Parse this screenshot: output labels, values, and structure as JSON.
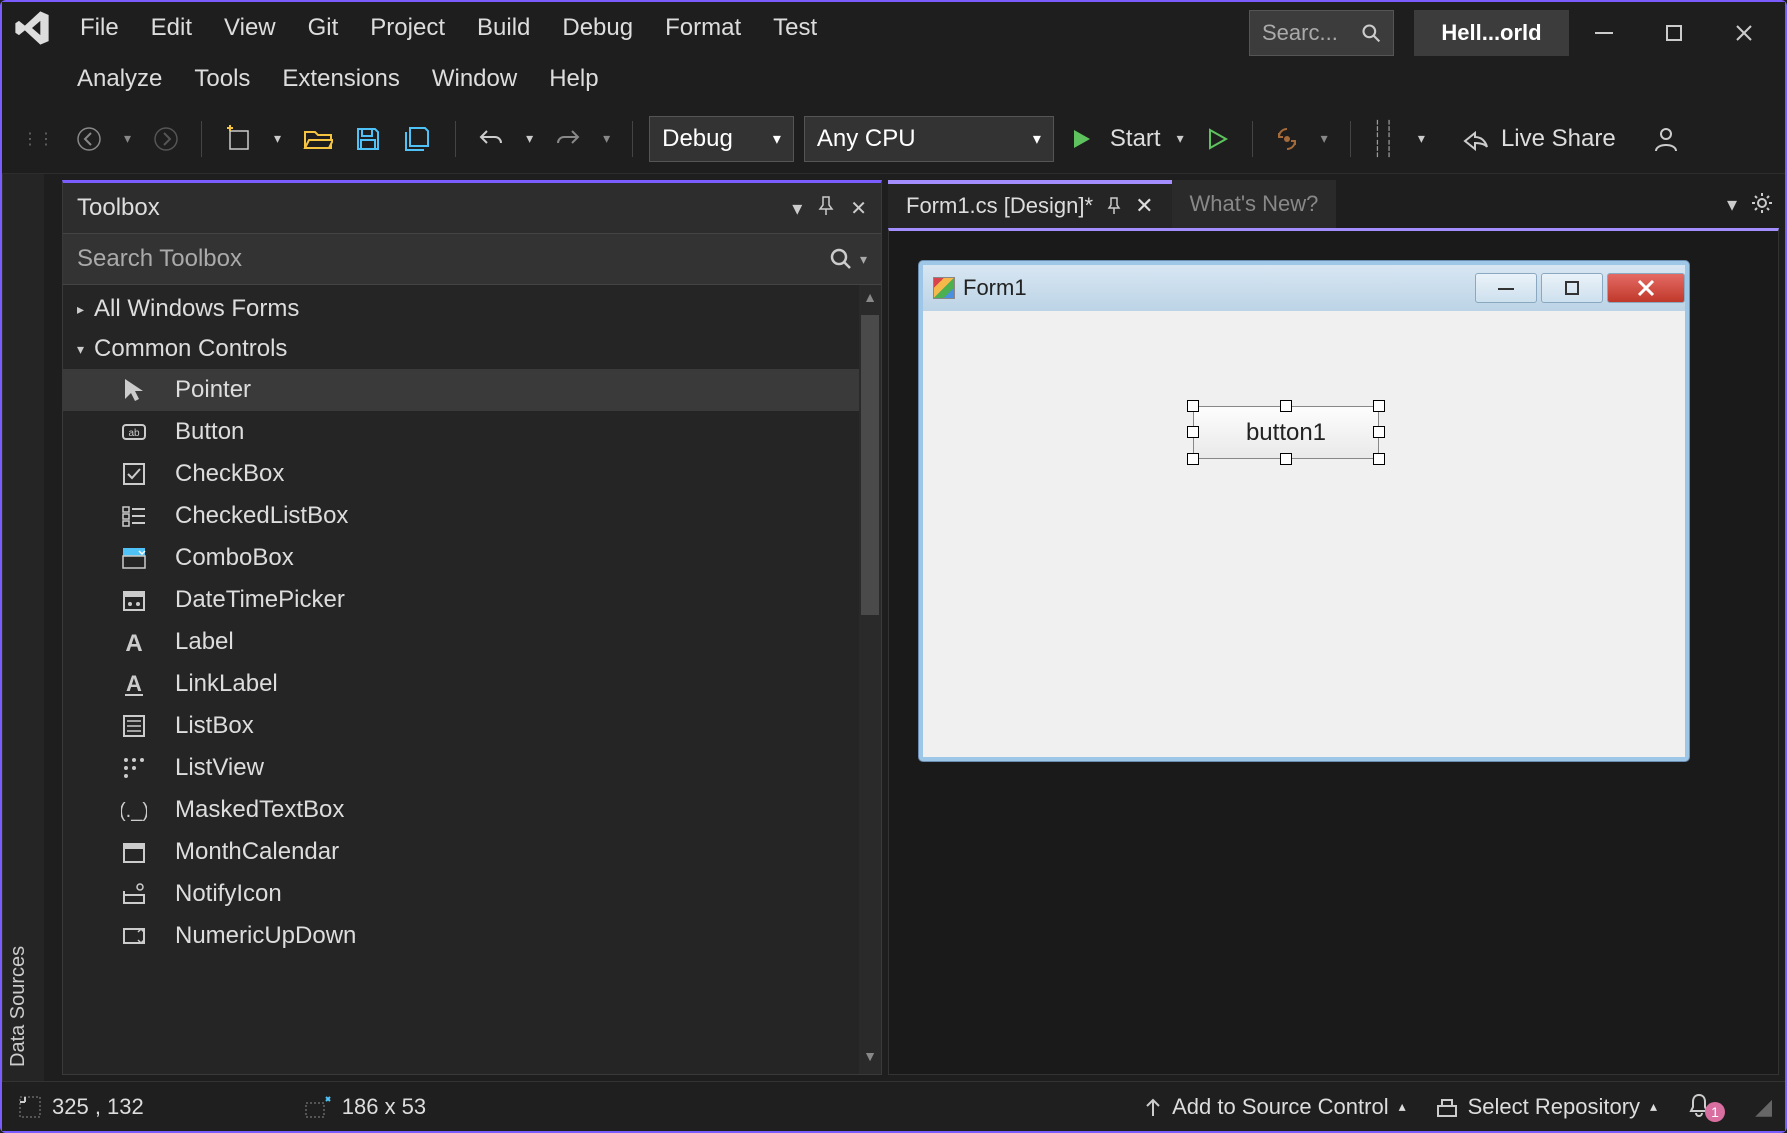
{
  "menu": {
    "row1": [
      "File",
      "Edit",
      "View",
      "Git",
      "Project",
      "Build",
      "Debug",
      "Format",
      "Test"
    ],
    "row2": [
      "Analyze",
      "Tools",
      "Extensions",
      "Window",
      "Help"
    ]
  },
  "titlebar": {
    "search_placeholder": "Searc...",
    "title": "Hell...orld"
  },
  "toolbar": {
    "config": "Debug",
    "platform": "Any CPU",
    "start": "Start",
    "live_share": "Live Share"
  },
  "toolbox": {
    "title": "Toolbox",
    "search_placeholder": "Search Toolbox",
    "groups": [
      {
        "label": "All Windows Forms",
        "expanded": false
      },
      {
        "label": "Common Controls",
        "expanded": true,
        "items": [
          {
            "label": "Pointer",
            "icon": "cursor",
            "selected": true
          },
          {
            "label": "Button",
            "icon": "ab"
          },
          {
            "label": "CheckBox",
            "icon": "check"
          },
          {
            "label": "CheckedListBox",
            "icon": "clb"
          },
          {
            "label": "ComboBox",
            "icon": "combo",
            "blue": true
          },
          {
            "label": "DateTimePicker",
            "icon": "date"
          },
          {
            "label": "Label",
            "icon": "A"
          },
          {
            "label": "LinkLabel",
            "icon": "Au"
          },
          {
            "label": "ListBox",
            "icon": "lb"
          },
          {
            "label": "ListView",
            "icon": "lv"
          },
          {
            "label": "MaskedTextBox",
            "icon": "mask"
          },
          {
            "label": "MonthCalendar",
            "icon": "cal"
          },
          {
            "label": "NotifyIcon",
            "icon": "notify"
          },
          {
            "label": "NumericUpDown",
            "icon": "num"
          }
        ]
      }
    ]
  },
  "tabs": {
    "active": "Form1.cs [Design]*",
    "inactive": "What's New?"
  },
  "form": {
    "title": "Form1",
    "button": "button1"
  },
  "status": {
    "pos": "325 , 132",
    "size": "186 x 53",
    "source": "Add to Source Control",
    "repo": "Select Repository",
    "notifications": "1"
  }
}
